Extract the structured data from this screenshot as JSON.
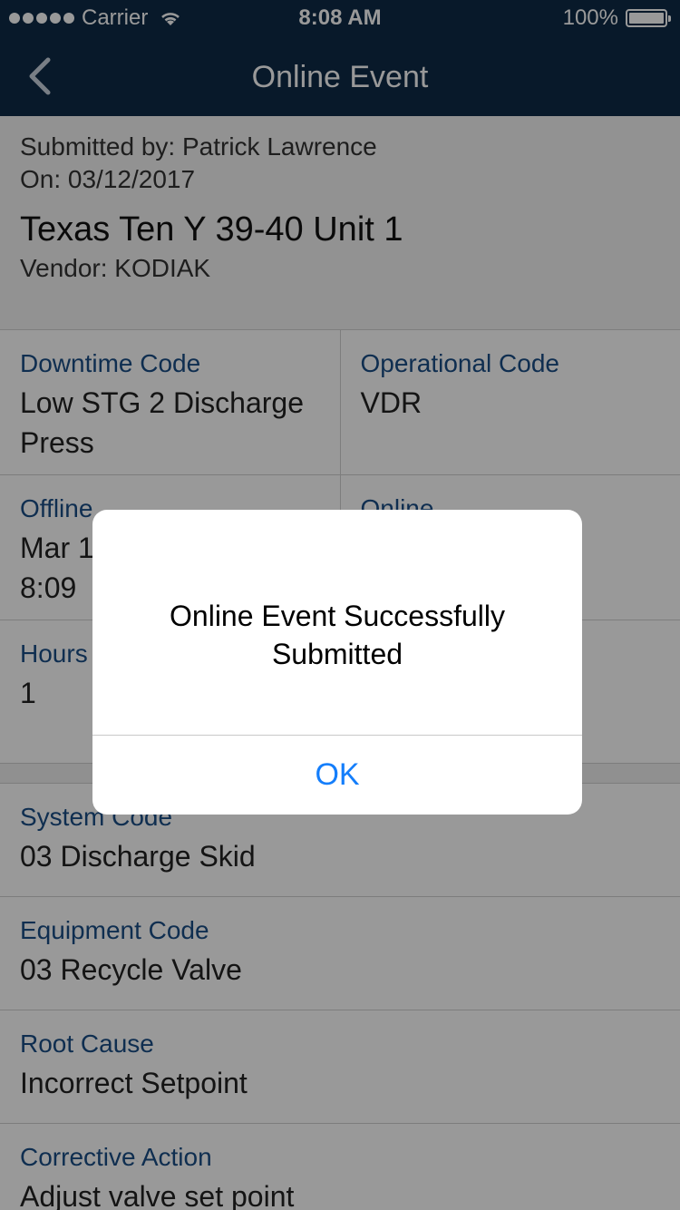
{
  "status_bar": {
    "carrier": "Carrier",
    "time": "8:08 AM",
    "battery": "100%"
  },
  "nav": {
    "title": "Online Event",
    "back_icon": "chevron-left-icon"
  },
  "header": {
    "submitted_by": "Submitted by: Patrick Lawrence",
    "on_date": "On: 03/12/2017",
    "title": "Texas Ten Y 39-40 Unit 1",
    "vendor": "Vendor: KODIAK"
  },
  "details": {
    "downtime_label": "Downtime Code",
    "downtime_value": "Low STG 2 Discharge Press",
    "operational_label": "Operational Code",
    "operational_value": "VDR",
    "offline_label": "Offline",
    "offline_value_line1": "Mar 1",
    "offline_value_line2": "8:09",
    "online_label": "Online",
    "hours_label": "Hours",
    "hours_value": "1"
  },
  "list": [
    {
      "label": "System Code",
      "value": "03 Discharge Skid"
    },
    {
      "label": "Equipment Code",
      "value": "03 Recycle Valve"
    },
    {
      "label": "Root Cause",
      "value": "Incorrect Setpoint"
    },
    {
      "label": "Corrective Action",
      "value": "Adjust valve set point"
    }
  ],
  "alert": {
    "message": "Online Event Successfully Submitted",
    "ok_label": "OK"
  },
  "colors": {
    "nav_bg": "#0e2a47",
    "label": "#1a4e86",
    "ios_blue": "#147efb"
  }
}
